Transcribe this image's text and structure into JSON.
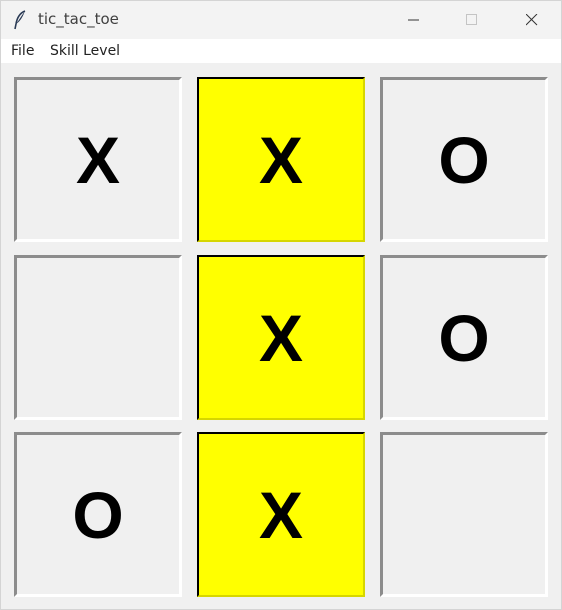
{
  "window": {
    "title": "tic_tac_toe"
  },
  "menu": {
    "file": "File",
    "skill_level": "Skill Level"
  },
  "board": {
    "cells": [
      "X",
      "X",
      "O",
      "",
      "X",
      "O",
      "O",
      "X",
      ""
    ],
    "highlight_color": "#ffff00"
  },
  "icons": {
    "app": "feather-icon",
    "minimize": "minimize-icon",
    "maximize": "maximize-icon",
    "close": "close-icon"
  }
}
